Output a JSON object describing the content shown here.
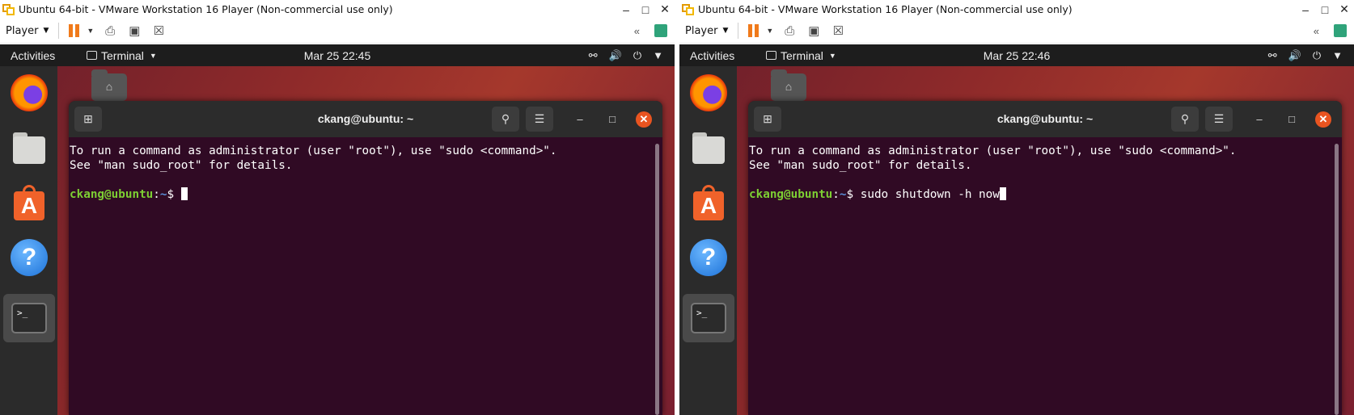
{
  "panels": [
    {
      "window_title": "Ubuntu 64-bit - VMware Workstation 16 Player (Non-commercial use only)",
      "player_menu": "Player",
      "topbar": {
        "activities": "Activities",
        "app_menu": "Terminal",
        "clock": "Mar 25  22:45"
      },
      "terminal": {
        "title": "ckang@ubuntu: ~",
        "line1": "To run a command as administrator (user \"root\"), use \"sudo <command>\".",
        "line2": "See \"man sudo_root\" for details.",
        "prompt_user": "ckang@ubuntu",
        "prompt_sep": ":",
        "prompt_path": "~",
        "prompt_symbol": "$ ",
        "command": ""
      }
    },
    {
      "window_title": "Ubuntu 64-bit - VMware Workstation 16 Player (Non-commercial use only)",
      "player_menu": "Player",
      "topbar": {
        "activities": "Activities",
        "app_menu": "Terminal",
        "clock": "Mar 25  22:46"
      },
      "terminal": {
        "title": "ckang@ubuntu: ~",
        "line1": "To run a command as administrator (user \"root\"), use \"sudo <command>\".",
        "line2": "See \"man sudo_root\" for details.",
        "prompt_user": "ckang@ubuntu",
        "prompt_sep": ":",
        "prompt_path": "~",
        "prompt_symbol": "$ ",
        "command": "sudo shutdown -h now"
      }
    }
  ],
  "colors": {
    "terminal_bg": "#300a24",
    "prompt_user": "#7dcf33",
    "close_button": "#e95420",
    "pause": "#f07a1a"
  },
  "icons": [
    "vmware-logo-icon",
    "pause-icon",
    "send-keys-icon",
    "fullscreen-icon",
    "unity-icon",
    "collapse-icon",
    "notes-icon",
    "firefox-icon",
    "files-icon",
    "software-icon",
    "help-icon",
    "terminal-icon",
    "network-icon",
    "volume-icon",
    "power-icon"
  ]
}
